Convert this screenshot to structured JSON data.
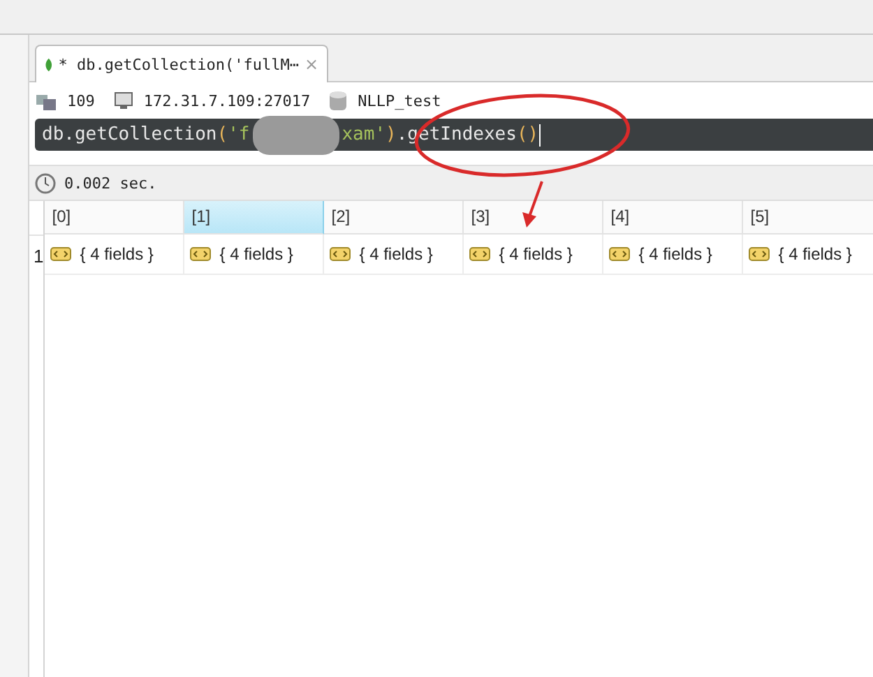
{
  "tab": {
    "title": "* db.getCollection('fullM⋯",
    "close": "×",
    "selected": true
  },
  "connection": {
    "count": "109",
    "server": "172.31.7.109:27017",
    "database": "NLLP_test"
  },
  "query": {
    "tokens": [
      {
        "kind": "plain",
        "text": "db.getCollection"
      },
      {
        "kind": "paren",
        "text": "("
      },
      {
        "kind": "string",
        "text": "'f"
      },
      {
        "kind": "redacted"
      },
      {
        "kind": "string",
        "text": "xam'"
      },
      {
        "kind": "paren",
        "text": ")"
      },
      {
        "kind": "plain",
        "text": ".getIndexes"
      },
      {
        "kind": "paren",
        "text": "()"
      }
    ]
  },
  "status": {
    "time": "0.002 sec."
  },
  "table": {
    "columns": [
      {
        "label": "[0]",
        "selected": false
      },
      {
        "label": "[1]",
        "selected": true
      },
      {
        "label": "[2]",
        "selected": false
      },
      {
        "label": "[3]",
        "selected": false
      },
      {
        "label": "[4]",
        "selected": false
      },
      {
        "label": "[5]",
        "selected": false
      }
    ],
    "rows": [
      {
        "number": "1",
        "cells": [
          "{ 4 fields }",
          "{ 4 fields }",
          "{ 4 fields }",
          "{ 4 fields }",
          "{ 4 fields }",
          "{ 4 fields }"
        ]
      }
    ]
  }
}
